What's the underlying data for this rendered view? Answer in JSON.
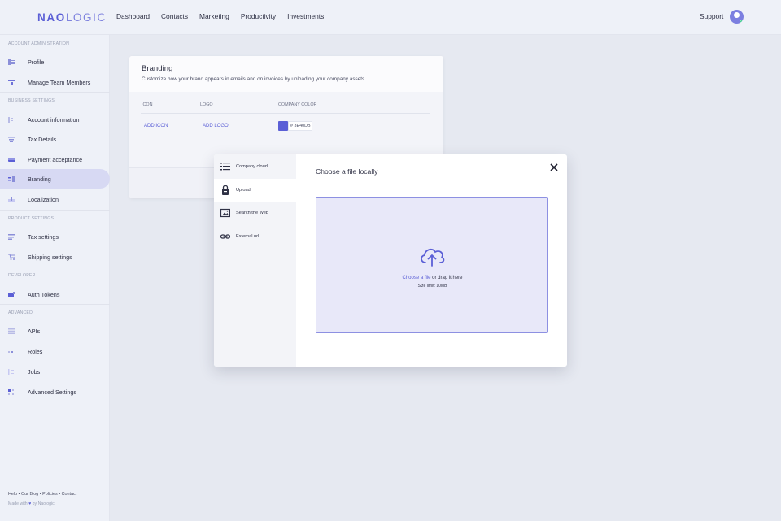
{
  "brand": {
    "logo_bold": "NAO",
    "logo_light": "LOGIC"
  },
  "nav": {
    "items": [
      "Dashboard",
      "Contacts",
      "Marketing",
      "Productivity",
      "Investments"
    ],
    "support": "Support"
  },
  "sidebar": {
    "sections": [
      "ACCOUNT ADMINISTRATION",
      "BUSINESS SETTINGS",
      "PRODUCT SETTINGS",
      "DEVELOPER",
      "ADVANCED"
    ],
    "items": [
      {
        "label": "Profile",
        "icon": "profile-icon"
      },
      {
        "label": "Manage Team Members",
        "icon": "team-icon"
      },
      {
        "label": "Account information",
        "icon": "account-info-icon"
      },
      {
        "label": "Tax Details",
        "icon": "tax-details-icon"
      },
      {
        "label": "Payment acceptance",
        "icon": "payment-icon"
      },
      {
        "label": "Branding",
        "icon": "branding-icon",
        "active": true
      },
      {
        "label": "Localization",
        "icon": "localization-icon"
      },
      {
        "label": "Tax settings",
        "icon": "tax-settings-icon"
      },
      {
        "label": "Shipping settings",
        "icon": "shipping-icon"
      },
      {
        "label": "Auth Tokens",
        "icon": "auth-tokens-icon"
      },
      {
        "label": "APIs",
        "icon": "apis-icon"
      },
      {
        "label": "Roles",
        "icon": "roles-icon"
      },
      {
        "label": "Jobs",
        "icon": "jobs-icon"
      },
      {
        "label": "Advanced Settings",
        "icon": "advanced-settings-icon"
      }
    ],
    "footer": {
      "links": "Help  •  Our Blog  •  Policies  •  Contact",
      "made_with": "Made with",
      "by": "by Naologic"
    }
  },
  "branding": {
    "title": "Branding",
    "subtitle": "Customize how your brand appears in emails and on invoices by uploading your company assets",
    "columns": [
      "ICON",
      "LOGO",
      "COMPANY COLOR"
    ],
    "add_icon": "ADD ICON",
    "add_logo": "ADD LOGO",
    "color_hex": "# 3E40DB"
  },
  "modal": {
    "options": [
      {
        "label": "Company cloud",
        "icon": "list-icon"
      },
      {
        "label": "Upload",
        "icon": "upload-icon",
        "active": true
      },
      {
        "label": "Search the Web",
        "icon": "image-search-icon"
      },
      {
        "label": "External url",
        "icon": "link-icon"
      }
    ],
    "title": "Choose a file locally",
    "choose_link": "Choose a file",
    "drag_text": " or drag it here",
    "size_limit": "Size limit: 10MB"
  },
  "colors": {
    "accent": "#5b5fd6",
    "active_bg": "#d7d9f3",
    "dropzone": "#e8e8f9"
  }
}
